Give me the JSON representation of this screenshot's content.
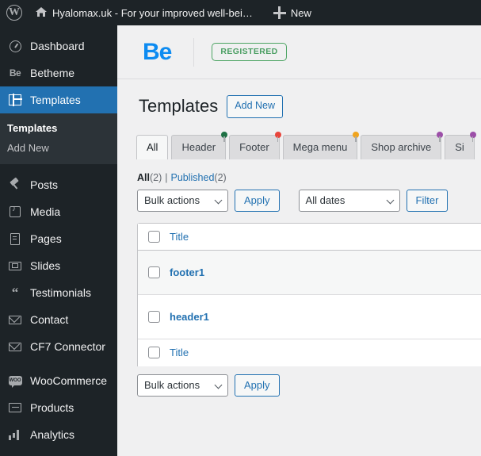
{
  "adminbar": {
    "wp_logo_icon": "wordpress-logo-icon",
    "home_icon": "home-icon",
    "site_name": "Hyalomax.uk - For your improved well-bei…",
    "new_icon": "plus-icon",
    "new_label": "New"
  },
  "sidebar": {
    "items": [
      {
        "label": "Dashboard",
        "icon": "dashboard-icon",
        "key": "dashboard",
        "current": false
      },
      {
        "label": "Betheme",
        "icon": "betheme-icon",
        "key": "betheme",
        "current": false
      },
      {
        "label": "Templates",
        "icon": "templates-icon",
        "key": "templates",
        "current": true
      },
      {
        "label": "Posts",
        "icon": "pin-icon",
        "key": "posts",
        "current": false
      },
      {
        "label": "Media",
        "icon": "media-icon",
        "key": "media",
        "current": false
      },
      {
        "label": "Pages",
        "icon": "pages-icon",
        "key": "pages",
        "current": false
      },
      {
        "label": "Slides",
        "icon": "slides-icon",
        "key": "slides",
        "current": false
      },
      {
        "label": "Testimonials",
        "icon": "quote-icon",
        "key": "testimonials",
        "current": false
      },
      {
        "label": "Contact",
        "icon": "mail-icon",
        "key": "contact",
        "current": false
      },
      {
        "label": "CF7 Connector",
        "icon": "mail-icon",
        "key": "cf7-connector",
        "current": false
      },
      {
        "label": "WooCommerce",
        "icon": "woocommerce-icon",
        "key": "woocommerce",
        "current": false
      },
      {
        "label": "Products",
        "icon": "products-icon",
        "key": "products",
        "current": false
      },
      {
        "label": "Analytics",
        "icon": "chart-icon",
        "key": "analytics",
        "current": false
      }
    ],
    "submenu": [
      {
        "label": "Templates",
        "current": true
      },
      {
        "label": "Add New",
        "current": false
      }
    ],
    "woo_icon_text": "WOO",
    "betheme_icon_text": "Be",
    "quote_icon_glyph": "“"
  },
  "brand": {
    "logo_text": "Be",
    "logo_color": "#0d8bf1",
    "badge_label": "REGISTERED",
    "badge_color": "#4a9e62"
  },
  "page": {
    "title": "Templates",
    "add_new_label": "Add New"
  },
  "tabs": [
    {
      "label": "All",
      "dot": null,
      "active": true
    },
    {
      "label": "Header",
      "dot": "#1e7145",
      "active": false
    },
    {
      "label": "Footer",
      "dot": "#e8453c",
      "active": false
    },
    {
      "label": "Mega menu",
      "dot": "#f0a41e",
      "active": false
    },
    {
      "label": "Shop archive",
      "dot": "#9c4fa8",
      "active": false
    },
    {
      "label": "Si",
      "dot": "#9c4fa8",
      "active": false
    }
  ],
  "views": {
    "all_label": "All",
    "all_count": "(2)",
    "separator": "|",
    "published_label": "Published",
    "published_count": "(2)"
  },
  "filters_top": {
    "bulk_label": "Bulk actions",
    "apply_label": "Apply",
    "dates_label": "All dates",
    "filter_label": "Filter",
    "chevron_icon": "chevron-down-icon"
  },
  "filters_bottom": {
    "bulk_label": "Bulk actions",
    "apply_label": "Apply",
    "chevron_icon": "chevron-down-icon"
  },
  "table": {
    "header": {
      "title": "Title"
    },
    "footer": {
      "title": "Title"
    },
    "rows": [
      {
        "title": "footer1",
        "alt": true
      },
      {
        "title": "header1",
        "alt": false
      }
    ]
  }
}
